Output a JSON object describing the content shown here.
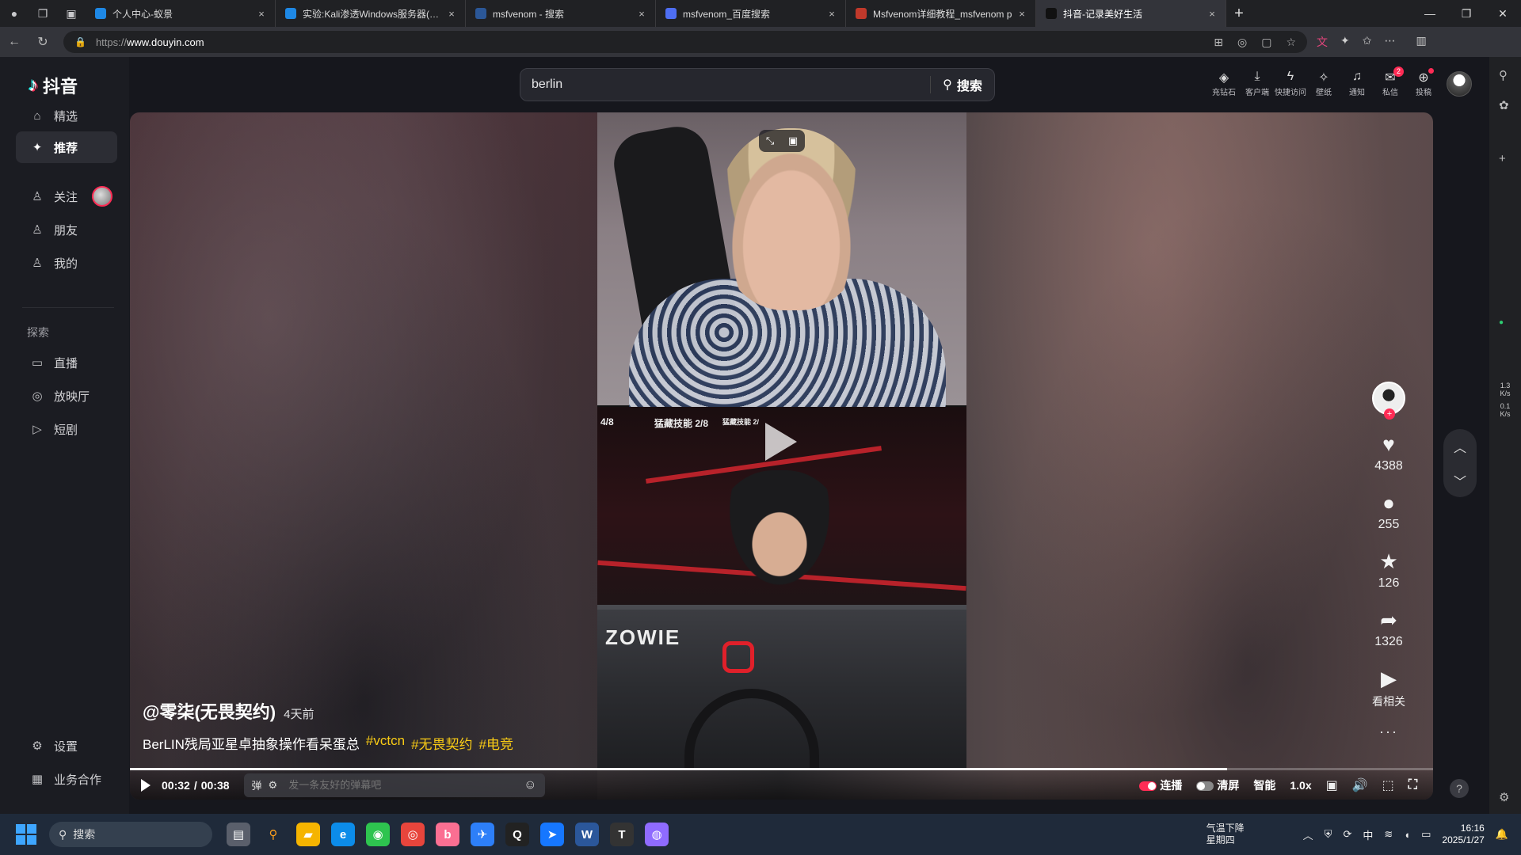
{
  "browser": {
    "tabs": [
      {
        "title": "个人中心-蚁景",
        "fav_color": "#1e88e5",
        "active": false
      },
      {
        "title": "实验:Kali渗透Windows服务器(蚁景",
        "fav_color": "#1e88e5",
        "active": false
      },
      {
        "title": "msfvenom - 搜索",
        "fav_color": "#2b5797",
        "active": false
      },
      {
        "title": "msfvenom_百度搜索",
        "fav_color": "#4e6ef2",
        "active": false
      },
      {
        "title": "Msfvenom详细教程_msfvenom p",
        "fav_color": "#c0392b",
        "active": false
      },
      {
        "title": "抖音-记录美好生活",
        "fav_color": "#111111",
        "active": true
      }
    ],
    "url_prefix": "https://",
    "url_host": "www.douyin.com",
    "new_tab": "+",
    "close": "×"
  },
  "sidebar": {
    "logo_text": "抖音",
    "items_main": [
      {
        "label": "精选",
        "icon": "home-icon"
      },
      {
        "label": "推荐",
        "icon": "sparkle-icon",
        "active": true
      }
    ],
    "items_social": [
      {
        "label": "关注",
        "icon": "follow-icon"
      },
      {
        "label": "朋友",
        "icon": "friends-icon"
      },
      {
        "label": "我的",
        "icon": "user-icon"
      }
    ],
    "section_explore": "探索",
    "items_explore": [
      {
        "label": "直播",
        "icon": "tv-icon"
      },
      {
        "label": "放映厅",
        "icon": "cinema-icon"
      },
      {
        "label": "短剧",
        "icon": "drama-icon"
      }
    ],
    "items_bottom": [
      {
        "label": "设置",
        "icon": "gear-icon"
      },
      {
        "label": "业务合作",
        "icon": "grid-icon"
      }
    ]
  },
  "header": {
    "search_value": "berlin",
    "search_button": "搜索",
    "tools": [
      {
        "label": "充钻石",
        "icon": "diamond-icon"
      },
      {
        "label": "客户端",
        "icon": "download-icon"
      },
      {
        "label": "快捷访问",
        "icon": "bolt-icon"
      },
      {
        "label": "壁纸",
        "icon": "wallpaper-icon"
      },
      {
        "label": "通知",
        "icon": "bell-icon"
      },
      {
        "label": "私信",
        "icon": "message-icon",
        "badge": "2"
      },
      {
        "label": "投稿",
        "icon": "upload-icon",
        "dot": true
      }
    ]
  },
  "video": {
    "author": "@零柒(无畏契约)",
    "time_ago": "4天前",
    "description": "BerLIN残局亚星卓抽象操作看呆蛋总",
    "tags": [
      "#vctcn",
      "#无畏契约",
      "#电竞"
    ],
    "hud": [
      "4/8",
      "猛藏技能 2/8",
      "猛藏技能 2/"
    ],
    "monitor_brand": "ZOWIE"
  },
  "actions": {
    "likes": "4388",
    "comments": "255",
    "favorites": "126",
    "shares": "1326",
    "related": "看相关",
    "more": "···"
  },
  "controls": {
    "current_time": "00:32",
    "separator": "/",
    "duration": "00:38",
    "progress": 0.842,
    "danmu_placeholder": "发一条友好的弹幕吧",
    "autoplay_label": "连播",
    "autoplay_on": true,
    "clear_label": "清屏",
    "clear_on": false,
    "quality": "智能",
    "speed": "1.0x"
  },
  "edge_panel": {
    "speed_up": "1.3",
    "speed_up_unit": "K/s",
    "speed_down": "0.1",
    "speed_down_unit": "K/s"
  },
  "taskbar": {
    "search_label": "搜索",
    "weather_title": "气温下降",
    "weather_day": "星期四",
    "weather_badge": "4",
    "ime": "中",
    "time": "16:16",
    "date": "2025/1/27"
  }
}
